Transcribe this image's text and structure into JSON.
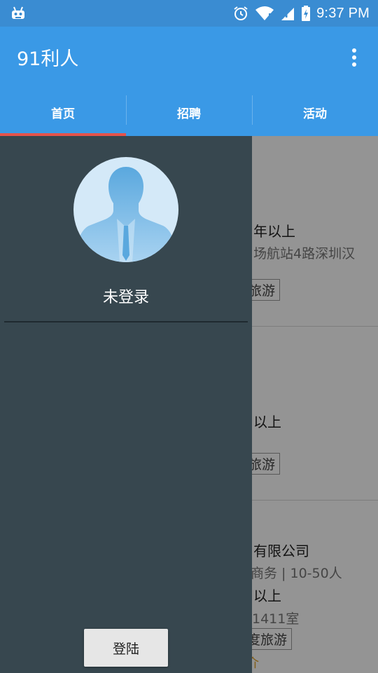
{
  "status_bar": {
    "time": "9:37 PM"
  },
  "app_bar": {
    "title": "91利人"
  },
  "tabs": [
    {
      "label": "首页",
      "active": true
    },
    {
      "label": "招聘",
      "active": false
    },
    {
      "label": "活动",
      "active": false
    }
  ],
  "content": {
    "cards": [
      {
        "line1": "年以上",
        "line2": "场航站4路深圳汉",
        "tag": "旅游"
      },
      {
        "line1": "以上",
        "tag": "旅游"
      },
      {
        "company": "有限公司",
        "industry": "商务 | 10-50人",
        "experience": "以上",
        "address": "1411室",
        "tag": "度旅游",
        "footer": "介"
      }
    ]
  },
  "drawer": {
    "user_status": "未登录",
    "login_button": "登陆"
  },
  "colors": {
    "status_bar": "#3a8cd2",
    "app_bar": "#3a99e6",
    "tab_indicator": "#e5534b",
    "drawer_bg": "#37474f",
    "avatar_bg": "#d4e9f8"
  }
}
